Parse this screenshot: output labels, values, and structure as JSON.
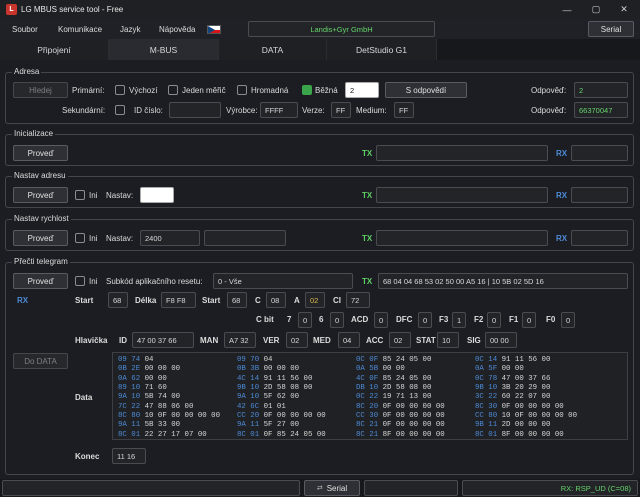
{
  "window": {
    "title": "LG MBUS service tool - Free"
  },
  "menu": {
    "items": [
      "Soubor",
      "Komunikace",
      "Jazyk",
      "Nápověda"
    ],
    "device": "Landis+Gyr GmbH",
    "serial_button": "Serial"
  },
  "tabs": [
    "Připojení",
    "M-BUS",
    "DATA",
    "DetStudio G1"
  ],
  "adresa": {
    "label": "Adresa",
    "search_button": "Hledej",
    "primary_label": "Primární:",
    "opt_default": "Výchozí",
    "opt_single": "Jeden měřič",
    "opt_broadcast": "Hromadná",
    "opt_normal": "Běžná",
    "primary_value": "2",
    "reply_button": "S odpovědí",
    "response_label": "Odpověď:",
    "response1": "2",
    "secondary_label": "Sekundární:",
    "id_label": "ID číslo:",
    "manufacturer_label": "Výrobce:",
    "manufacturer_value": "FFFF",
    "version_label": "Verze:",
    "version_value": "FF",
    "medium_label": "Medium:",
    "medium_value": "FF",
    "response2": "66370047"
  },
  "init": {
    "label": "Inicializace",
    "button": "Proveď",
    "tx": "TX",
    "rx": "RX"
  },
  "set_address": {
    "label": "Nastav adresu",
    "button": "Proveď",
    "ini": "Ini",
    "set_label": "Nastav:",
    "tx": "TX",
    "rx": "RX"
  },
  "set_speed": {
    "label": "Nastav rychlost",
    "button": "Proveď",
    "ini": "Ini",
    "set_label": "Nastav:",
    "set_value": "2400",
    "tx": "TX",
    "rx": "RX"
  },
  "read": {
    "label": "Přečti telegram",
    "button": "Proveď",
    "ini": "Ini",
    "subcode_label": "Subkód aplikačního resetu:",
    "subcode_value": "0 - Vše",
    "tx": "TX",
    "tx_value": "68 04 04 68 53 02 50 00 A5 16 | 10 5B 02 5D 16",
    "rx": "RX",
    "start_label": "Start",
    "start_value": "68",
    "length_label": "Délka",
    "length_value": "F8 F8",
    "start2_label": "Start",
    "start2_value": "68",
    "c_label": "C",
    "c_value": "08",
    "a_label": "A",
    "a_value": "02",
    "ci_label": "CI",
    "ci_value": "72",
    "cbit_label": "C bit",
    "bits": [
      {
        "label": "7",
        "value": "0"
      },
      {
        "label": "6",
        "value": "0"
      },
      {
        "label": "ACD",
        "value": "0"
      },
      {
        "label": "DFC",
        "value": "0"
      },
      {
        "label": "F3",
        "value": "1"
      },
      {
        "label": "F2",
        "value": "0"
      },
      {
        "label": "F1",
        "value": "0"
      },
      {
        "label": "F0",
        "value": "0"
      }
    ],
    "header_label": "Hlavička",
    "id_label": "ID",
    "id_value": "47 00 37 66",
    "man_label": "MAN",
    "man_value": "A7 32",
    "ver_label": "VER",
    "ver_value": "02",
    "med_label": "MED",
    "med_value": "04",
    "acc_label": "ACC",
    "acc_value": "02",
    "stat_label": "STAT",
    "stat_value": "10",
    "sig_label": "SIG",
    "sig_value": "00 00",
    "to_data_button": "Do DATA",
    "data_label": "Data",
    "data_columns": [
      [
        "09 74 04",
        "0B 2E 00 00 00",
        "0A 62 00 00",
        "89 10 71 60",
        "9A 10 5B 74 00",
        "7C 22 47 88 06 00",
        "8C 80 10 0F 00 00 00 00",
        "9A 11 5B 33 00",
        "8C 01 22 27 17 07 00"
      ],
      [
        "09 70 04",
        "0B 3B 00 00 00",
        "4C 14 91 11 56 00",
        "9B 10 2D 58 08 00",
        "9A 10 5F 62 00",
        "42 6C 01 01",
        "CC 20 0F 00 00 00 00",
        "9A 11 5F 27 00",
        "8C 01 0F 85 24 05 00"
      ],
      [
        "0C 0F 85 24 05 00",
        "0A 5B 00 00",
        "4C 0F 85 24 05 00",
        "DB 10 2D 58 08 00",
        "0C 22 19 71 13 00",
        "8C 20 0F 00 00 00 00",
        "CC 30 0F 00 00 00 00",
        "8C 21 0F 00 00 00 00",
        "8C 21 8F 00 00 00 00"
      ],
      [
        "0C 14 91 11 56 00",
        "0A 5F 00 00",
        "0C 78 47 00 37 66",
        "9B 10 3B 20 29 00",
        "3C 22 60 22 07 00",
        "8C 30 0F 00 00 00 00",
        "CC 80 10 0F 00 00 00 00",
        "9B 11 2D 00 00 00",
        "8C 01 8F 00 00 00 00"
      ]
    ],
    "end_label": "Konec",
    "end_value": "11 16"
  },
  "status": {
    "serial_button": "Serial",
    "result": "RX: RSP_UD (C=08)"
  },
  "colors": {
    "tx": "#5fcf63",
    "rx": "#4d8bd6",
    "accent_green": "#3aa54a",
    "code_byte": "#4d8bd6"
  }
}
